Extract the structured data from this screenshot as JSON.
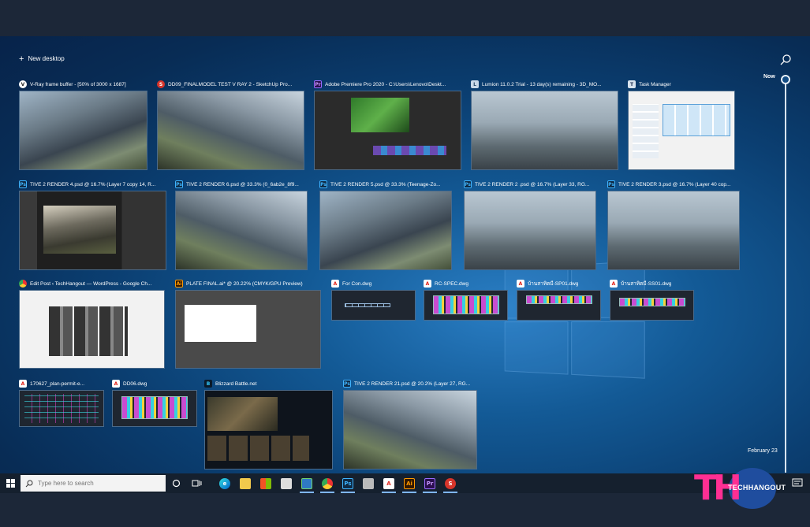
{
  "new_desktop": {
    "label": "New desktop"
  },
  "timeline": {
    "now_label": "Now",
    "date_label": "February 23"
  },
  "rows": [
    [
      {
        "title": "V-Ray frame buffer - [50% of 3000 x 1687]",
        "icon": "vray-icon",
        "icon_text": "V"
      },
      {
        "title": "DD09_FINALMODEL TEST V RAY 2 - SketchUp Pro...",
        "icon": "sketchup-icon",
        "icon_text": "S"
      },
      {
        "title": "Adobe Premiere Pro 2020 - C:\\Users\\Lenovo\\Deskt...",
        "icon": "premiere-icon",
        "icon_text": "Pr"
      },
      {
        "title": "Lumion 11.0.2 Trial - 13 day(s) remaining - 3D_MO...",
        "icon": "lumion-icon",
        "icon_text": "L"
      },
      {
        "title": "Task Manager",
        "icon": "task-manager-icon",
        "icon_text": "T"
      }
    ],
    [
      {
        "title": "TIVE 2 RENDER 4.psd @ 16.7% (Layer 7 copy 14, R...",
        "icon": "photoshop-icon",
        "icon_text": "Ps"
      },
      {
        "title": "TIVE 2 RENDER 6.psd @ 33.3% (0_6ab2e_8f9...",
        "icon": "photoshop-icon",
        "icon_text": "Ps"
      },
      {
        "title": "TIVE 2 RENDER 5.psd @ 33.3% (Teenage-Zo...",
        "icon": "photoshop-icon",
        "icon_text": "Ps"
      },
      {
        "title": "TIVE 2 RENDER 2 .psd @ 16.7% (Layer 33, RG...",
        "icon": "photoshop-icon",
        "icon_text": "Ps"
      },
      {
        "title": "TIVE 2 RENDER 3.psd @ 16.7% (Layer 40 cop...",
        "icon": "photoshop-icon",
        "icon_text": "Ps"
      }
    ],
    [
      {
        "title": "Edit Post ‹ TechHangout — WordPress - Google Ch...",
        "icon": "chrome-icon",
        "icon_text": ""
      },
      {
        "title": "PLATE FINAL.ai* @ 20.22% (CMYK/GPU Preview)",
        "icon": "illustrator-icon",
        "icon_text": "Ai"
      },
      {
        "title": "For Con.dwg",
        "icon": "autocad-icon",
        "icon_text": "A"
      },
      {
        "title": "RC-SPEC.dwg",
        "icon": "autocad-icon",
        "icon_text": "A"
      },
      {
        "title": "บ้านสาทิตมี-SP01.dwg",
        "icon": "autocad-icon",
        "icon_text": "A"
      },
      {
        "title": "บ้านสาทิตมี-SS01.dwg",
        "icon": "autocad-icon",
        "icon_text": "A"
      }
    ],
    [
      {
        "title": "170627_plan-permit-e...",
        "icon": "autocad-icon",
        "icon_text": "A"
      },
      {
        "title": "DD06.dwg",
        "icon": "autocad-icon",
        "icon_text": "A"
      },
      {
        "title": "Blizzard Battle.net",
        "icon": "battlenet-icon",
        "icon_text": "B"
      },
      {
        "title": "TIVE 2 RENDER 21.psd @ 20.2% (Layer 27, RG...",
        "icon": "photoshop-icon",
        "icon_text": "Ps"
      }
    ]
  ],
  "taskbar": {
    "search_placeholder": "Type here to search",
    "apps": [
      {
        "name": "edge-icon",
        "text": "e"
      },
      {
        "name": "file-explorer-icon",
        "text": ""
      },
      {
        "name": "store-icon",
        "text": ""
      },
      {
        "name": "mail-icon",
        "text": ""
      },
      {
        "name": "lumion-taskbar-icon",
        "text": ""
      },
      {
        "name": "chrome-taskbar-icon",
        "text": ""
      },
      {
        "name": "photoshop-taskbar-icon",
        "text": "Ps"
      },
      {
        "name": "printer-icon",
        "text": ""
      },
      {
        "name": "autocad-taskbar-icon",
        "text": "A"
      },
      {
        "name": "illustrator-taskbar-icon",
        "text": "Ai"
      },
      {
        "name": "premiere-taskbar-icon",
        "text": "Pr"
      },
      {
        "name": "sketchup-taskbar-icon",
        "text": "S"
      },
      {
        "name": "battlenet-taskbar-icon",
        "text": ""
      }
    ]
  },
  "brand": {
    "logo_letters": "TH",
    "label": "TECHHANGOUT"
  }
}
